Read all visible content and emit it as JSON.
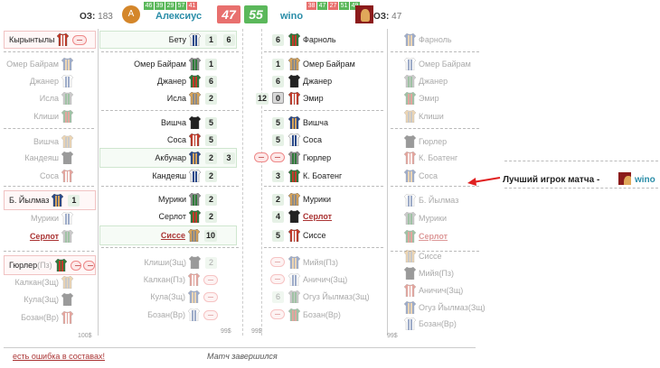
{
  "header": {
    "left_oz_label": "ОЗ:",
    "left_oz_value": "183",
    "left_avatar": "A",
    "left_mini": [
      "46",
      "39",
      "29",
      "57",
      "41"
    ],
    "left_user": "Алексиус",
    "left_score": "47",
    "right_score": "55",
    "right_user": "wino",
    "right_mini": [
      "38",
      "47",
      "27",
      "51",
      "49"
    ],
    "right_oz_label": "ОЗ:",
    "right_oz_value": "47"
  },
  "left_bench": [
    {
      "name": "Кырынтылы",
      "ghost": false,
      "btn": true
    },
    {
      "name": "Омер Байрам",
      "ghost": true
    },
    {
      "name": "Джанер",
      "ghost": true
    },
    {
      "name": "Исла",
      "ghost": true
    },
    {
      "name": "Клиши",
      "ghost": true
    },
    {
      "name": "Вишча",
      "ghost": true
    },
    {
      "name": "Кандеяш",
      "ghost": true
    },
    {
      "name": "Соса",
      "ghost": true
    },
    {
      "name": "Б. Йылмаз",
      "ghost": false,
      "num": "1"
    },
    {
      "name": "Мурики",
      "ghost": true
    },
    {
      "name": "Серлот",
      "ghost": true,
      "link": true
    },
    {
      "name": "Гюрлер",
      "pos": "(Пз)",
      "ghost": false,
      "btn": true
    },
    {
      "name": "Калкан",
      "pos": "(Зщ)",
      "ghost": true
    },
    {
      "name": "Кула",
      "pos": "(Зщ)",
      "ghost": true
    },
    {
      "name": "Бозан",
      "pos": "(Вр)",
      "ghost": true
    }
  ],
  "left_bench_money": "100$",
  "left_main": [
    {
      "name": "Бету",
      "a": "1",
      "b": "6"
    },
    {
      "name": "Омер Байрам",
      "a": "1"
    },
    {
      "name": "Джанер",
      "a": "6"
    },
    {
      "name": "Исла",
      "a": "2"
    },
    {
      "name": "Вишча",
      "a": "5"
    },
    {
      "name": "Соса",
      "a": "5"
    },
    {
      "name": "Акбунар",
      "a": "2",
      "b": "3"
    },
    {
      "name": "Кандеяш",
      "a": "2"
    },
    {
      "name": "Мурики",
      "a": "2"
    },
    {
      "name": "Серлот",
      "a": "2"
    },
    {
      "name": "Сиссе",
      "a": "10",
      "link": true
    },
    {
      "name": "Клиши",
      "pos": "(Зщ)",
      "a": "2",
      "ghost": true
    },
    {
      "name": "Калкан",
      "pos": "(Пз)",
      "ghost": true
    },
    {
      "name": "Кула",
      "pos": "(Зщ)",
      "ghost": true
    },
    {
      "name": "Бозан",
      "pos": "(Вр)",
      "ghost": true
    }
  ],
  "left_main_money": "99$",
  "right_main": [
    {
      "name": "Фарноль",
      "a": "6"
    },
    {
      "name": "Омер Байрам",
      "a": "1"
    },
    {
      "name": "Джанер",
      "a": "6"
    },
    {
      "name": "Эмир",
      "a": "12",
      "b": "0"
    },
    {
      "name": "Вишча",
      "a": "5"
    },
    {
      "name": "Соса",
      "a": "5"
    },
    {
      "name": "Гюрлер",
      "btn": true
    },
    {
      "name": "К. Боатенг",
      "a": "3"
    },
    {
      "name": "Мурики",
      "a": "2"
    },
    {
      "name": "Серлот",
      "a": "4",
      "link": true
    },
    {
      "name": "Сиссе",
      "a": "5"
    },
    {
      "name": "Мийя",
      "pos": "(Пз)",
      "ghost": true
    },
    {
      "name": "Аничич",
      "pos": "(Зщ)",
      "ghost": true
    },
    {
      "name": "Огуз Йылмаз",
      "pos": "(Зщ)",
      "a": "6",
      "ghost": true
    },
    {
      "name": "Бозан",
      "pos": "(Вр)",
      "ghost": true
    }
  ],
  "right_main_money": "99$",
  "right_bench": [
    {
      "name": "Фарноль"
    },
    {
      "name": "Омер Байрам"
    },
    {
      "name": "Джанер"
    },
    {
      "name": "Эмир"
    },
    {
      "name": "Клиши"
    },
    {
      "name": "Гюрлер"
    },
    {
      "name": "К. Боатенг"
    },
    {
      "name": "Соса"
    },
    {
      "name": "Б. Йылмаз"
    },
    {
      "name": "Мурики"
    },
    {
      "name": "Серлот",
      "link": true
    },
    {
      "name": "Сиссе"
    },
    {
      "name": "Мийя",
      "pos": "(Пз)"
    },
    {
      "name": "Аничич",
      "pos": "(Зщ)"
    },
    {
      "name": "Огуз Йылмаз",
      "pos": "(Зщ)"
    },
    {
      "name": "Бозан",
      "pos": "(Вр)"
    }
  ],
  "right_bench_money": "99$",
  "best_player": {
    "label": "Лучший игрок матча -",
    "user": "wino"
  },
  "footer": {
    "error_link": "есть ошибка в составах!",
    "status": "Матч завершился"
  },
  "colors": {
    "accent": "#2a8da8",
    "green": "#5bb85b",
    "red": "#e8706e",
    "link": "#a33333"
  }
}
